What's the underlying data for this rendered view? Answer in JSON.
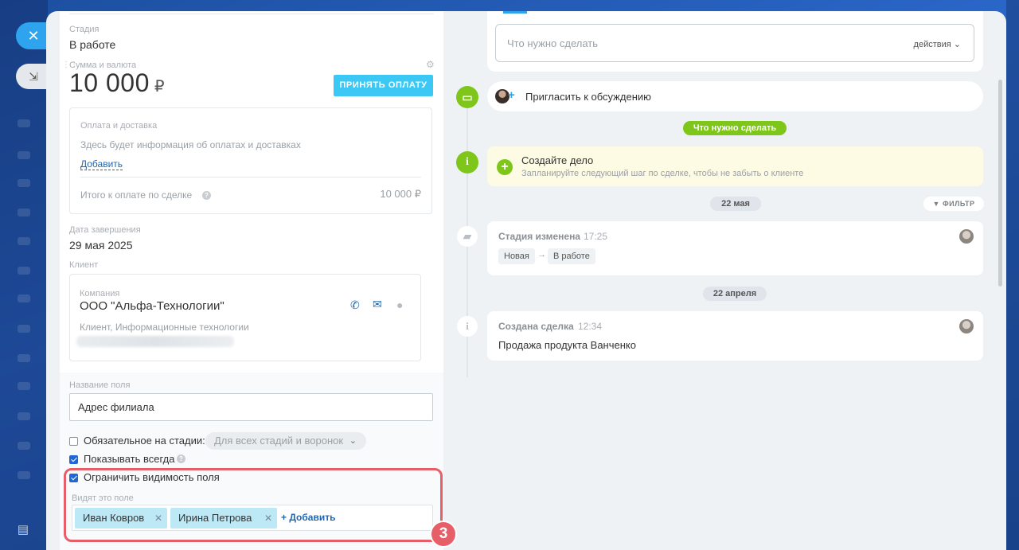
{
  "colors": {
    "accent": "#3bc8f5",
    "link": "#2067b0",
    "green": "#7fc61a",
    "highlight": "#e65f68"
  },
  "left": {
    "stage_label": "Стадия",
    "stage_value": "В работе",
    "amount_label": "Сумма и валюта",
    "amount_value": "10 000",
    "currency": "₽",
    "pay_button": "ПРИНЯТЬ ОПЛАТУ",
    "payment": {
      "title": "Оплата и доставка",
      "info": "Здесь будет информация об оплатах и доставках",
      "add_link": "Добавить",
      "total_label": "Итого к оплате по сделке",
      "total_value": "10 000 ₽"
    },
    "end_date_label": "Дата завершения",
    "end_date_value": "29 мая 2025",
    "client_label": "Клиент",
    "client": {
      "company_label": "Компания",
      "company_name": "ООО \"Альфа-Технологии\"",
      "details": "Клиент, Информационные технологии"
    },
    "field_name_label": "Название поля",
    "field_name_value": "Адрес филиала",
    "required_label": "Обязательное на стадии:",
    "required_select": "Для всех стадий и воронок",
    "show_always_label": "Показывать всегда",
    "restrict_label": "Ограничить видимость поля",
    "visible_to_label": "Видят это поле",
    "users": [
      "Иван Ковров",
      "Ирина Петрова"
    ],
    "add_user": "+ Добавить",
    "step_number": "3"
  },
  "right": {
    "todo_placeholder": "Что нужно сделать",
    "actions_label": "действия",
    "invite_label": "Пригласить к обсуждению",
    "todo_pill": "Что нужно сделать",
    "create_title": "Создайте дело",
    "create_subtitle": "Запланируйте следующий шаг по сделке, чтобы не забыть о клиенте",
    "date1": "22 мая",
    "filter": "ФИЛЬТР",
    "event1": {
      "title": "Стадия изменена",
      "time": "17:25",
      "from": "Новая",
      "arrow": "→",
      "to": "В работе"
    },
    "date2": "22 апреля",
    "event2": {
      "title": "Создана сделка",
      "time": "12:34",
      "text": "Продажа продукта Ванченко"
    }
  }
}
